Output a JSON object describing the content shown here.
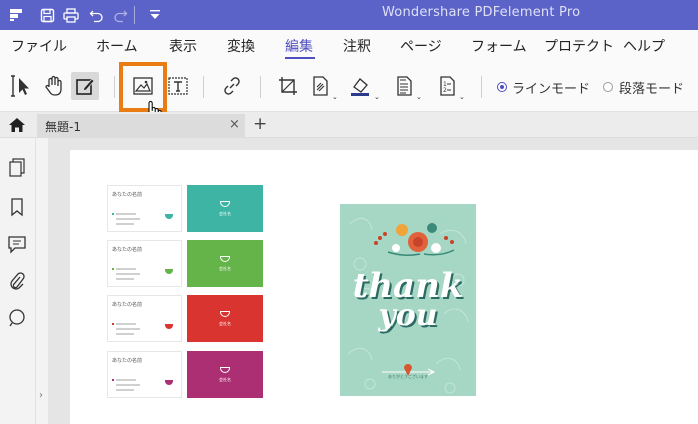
{
  "app": {
    "title": "Wondershare PDFelement Pro",
    "accent_color": "#5b63c9",
    "highlight_color": "#ea7c14"
  },
  "titlebar": {
    "icons": [
      "app-menu-icon",
      "save-icon",
      "print-icon",
      "undo-icon",
      "redo-icon",
      "quick-access-dropdown-icon"
    ]
  },
  "menu": {
    "items": [
      "ファイル",
      "ホーム",
      "表示",
      "変換",
      "編集",
      "注釈",
      "ページ",
      "フォーム",
      "プロテクト",
      "ヘルプ"
    ],
    "active": "編集"
  },
  "toolbar": {
    "tools": [
      "select-cursor-icon",
      "hand-icon",
      "edit-text-icon",
      "add-image-icon",
      "add-text-box-icon",
      "link-icon",
      "crop-icon",
      "watermark-icon",
      "background-icon",
      "header-footer-icon",
      "bates-numbering-icon"
    ],
    "selected_tool": "edit-text-icon",
    "highlighted_tool": "add-image-icon",
    "line_mode_label": "ラインモード",
    "paragraph_mode_label": "段落モード",
    "mode_selected": "ラインモード"
  },
  "tabs": {
    "home_icon": "home-icon",
    "document_tab": "無題-1",
    "close_glyph": "×",
    "new_tab_glyph": "+"
  },
  "sidebar": {
    "icons": [
      "page-thumbnails-icon",
      "bookmark-icon",
      "comment-icon",
      "attachment-icon",
      "search-icon"
    ]
  },
  "document": {
    "business_cards": [
      {
        "name": "あなたの名前",
        "back_color": "#3db4a4",
        "brand": "会社名"
      },
      {
        "name": "あなたの名前",
        "back_color": "#64b44a",
        "brand": "会社名"
      },
      {
        "name": "あなたの名前",
        "back_color": "#d93430",
        "brand": "会社名"
      },
      {
        "name": "あなたの名前",
        "back_color": "#ac2f74",
        "brand": "会社名"
      }
    ],
    "thank_card": {
      "line1": "thank",
      "line2": "you",
      "footer": "ありがとうございます",
      "background": "#a6d6c4"
    }
  }
}
